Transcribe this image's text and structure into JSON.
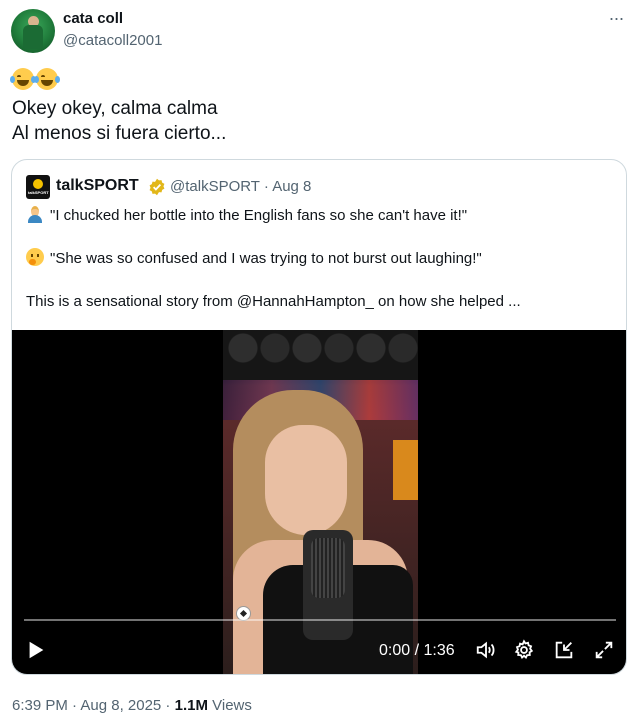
{
  "author": {
    "name": "cata coll",
    "handle": "@catacoll2001"
  },
  "tweet": {
    "emoji": "😂😂",
    "lines": [
      "Okey okey, calma calma",
      "Al menos si fuera cierto..."
    ]
  },
  "quote": {
    "name": "talkSPORT",
    "handle_date": "@talkSPORT · Aug 8",
    "line1": "\"I chucked her bottle into the English fans so she can't have it!\"",
    "line2": "\"She was so confused and I was trying to not burst out laughing!\"",
    "line3": "This is a sensational story from @HannahHampton_ on how she helped ..."
  },
  "video": {
    "time": "0:00 / 1:36",
    "progress": 0
  },
  "meta": {
    "time_date": "6:39 PM · Aug 8, 2025 · ",
    "views_count": "1.1M",
    "views_label": " Views"
  },
  "colors": {
    "text": "#0f1419",
    "secondary": "#536471",
    "border": "#cfd9de",
    "verified": "#e2b719"
  }
}
